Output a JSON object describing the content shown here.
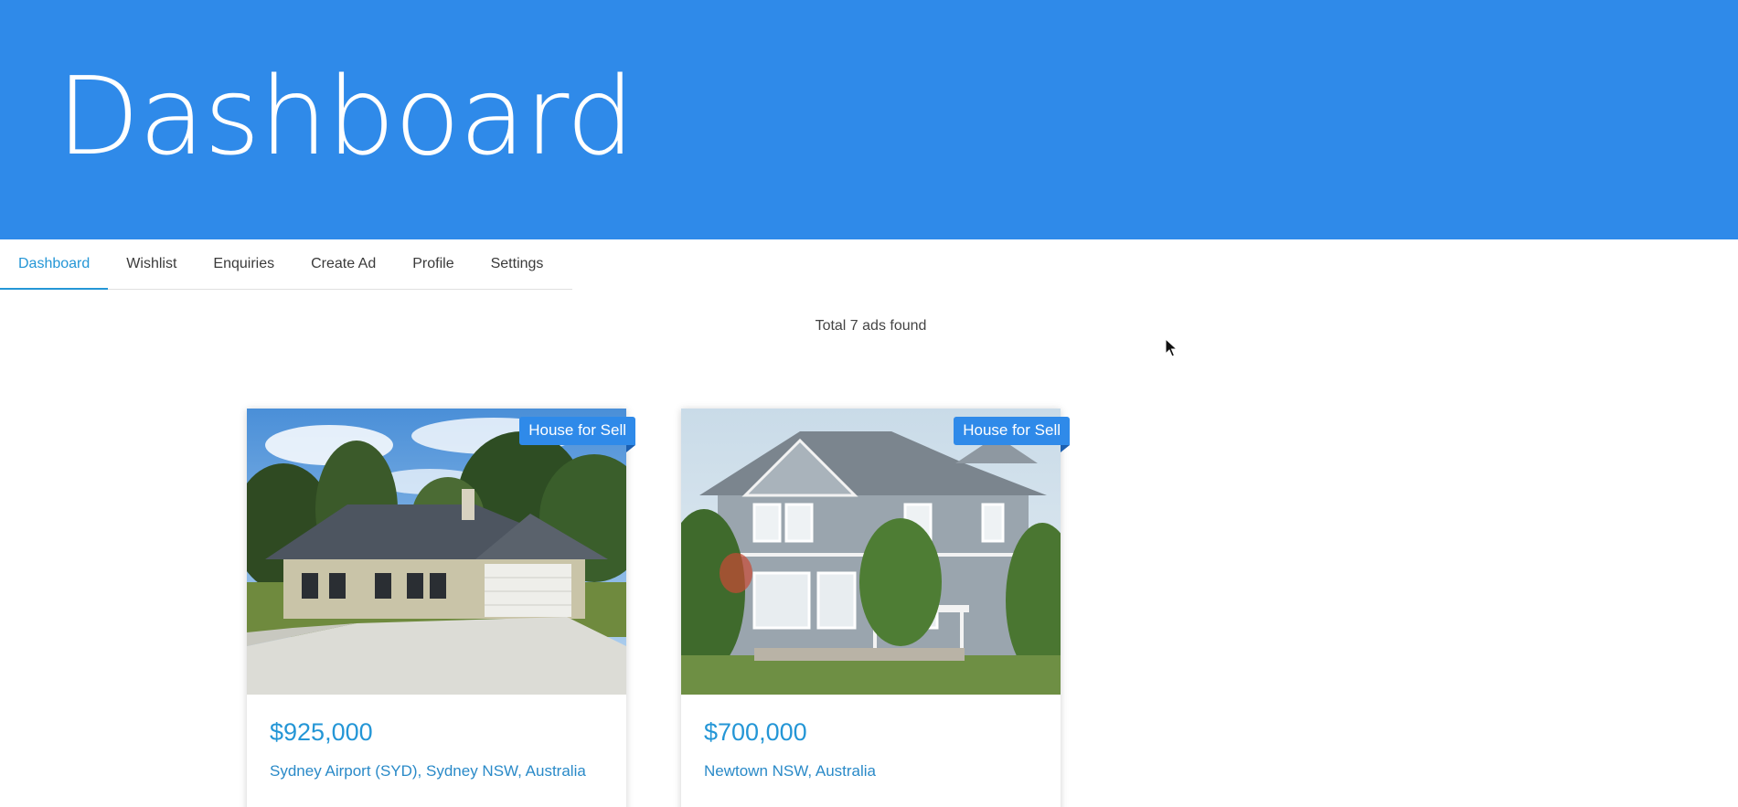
{
  "header": {
    "title": "Dashboard",
    "background": "#2f8ae9"
  },
  "tabs": [
    {
      "label": "Dashboard",
      "active": true
    },
    {
      "label": "Wishlist",
      "active": false
    },
    {
      "label": "Enquiries",
      "active": false
    },
    {
      "label": "Create Ad",
      "active": false
    },
    {
      "label": "Profile",
      "active": false
    },
    {
      "label": "Settings",
      "active": false
    }
  ],
  "results": {
    "total_text": "Total 7 ads found"
  },
  "listings": [
    {
      "badge": "House for Sell",
      "price": "$925,000",
      "location": "Sydney Airport (SYD), Sydney NSW, Australia",
      "image": "ranch-house-photo"
    },
    {
      "badge": "House for Sell",
      "price": "$700,000",
      "location": "Newtown NSW, Australia",
      "image": "two-storey-house-photo"
    }
  ],
  "colors": {
    "accent": "#2496d6",
    "badge": "#2f8ae9"
  }
}
